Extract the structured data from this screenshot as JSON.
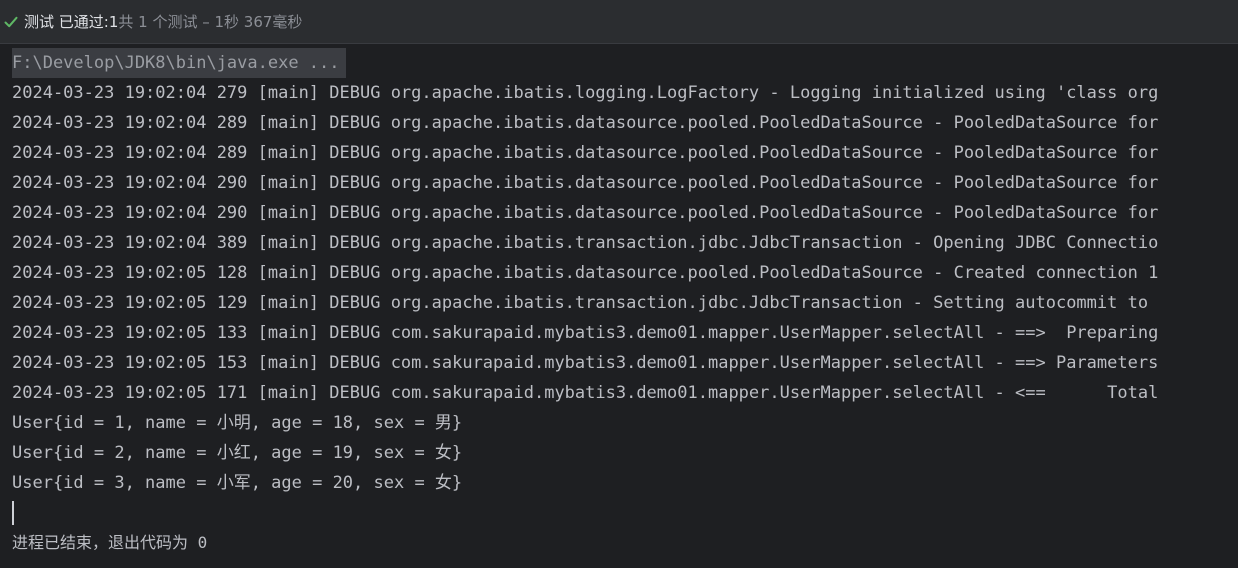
{
  "status_bar": {
    "icon": "check-icon",
    "icon_color": "#5fb865",
    "passed_label": "测试 已通过: ",
    "passed_count": "1",
    "detail": "共 1 个测试 – 1秒 367毫秒"
  },
  "console": {
    "command": "F:\\Develop\\JDK8\\bin\\java.exe ...",
    "log_lines": [
      "2024-03-23 19:02:04 279 [main] DEBUG org.apache.ibatis.logging.LogFactory - Logging initialized using 'class org",
      "2024-03-23 19:02:04 289 [main] DEBUG org.apache.ibatis.datasource.pooled.PooledDataSource - PooledDataSource for",
      "2024-03-23 19:02:04 289 [main] DEBUG org.apache.ibatis.datasource.pooled.PooledDataSource - PooledDataSource for",
      "2024-03-23 19:02:04 290 [main] DEBUG org.apache.ibatis.datasource.pooled.PooledDataSource - PooledDataSource for",
      "2024-03-23 19:02:04 290 [main] DEBUG org.apache.ibatis.datasource.pooled.PooledDataSource - PooledDataSource for",
      "2024-03-23 19:02:04 389 [main] DEBUG org.apache.ibatis.transaction.jdbc.JdbcTransaction - Opening JDBC Connectio",
      "2024-03-23 19:02:05 128 [main] DEBUG org.apache.ibatis.datasource.pooled.PooledDataSource - Created connection 1",
      "2024-03-23 19:02:05 129 [main] DEBUG org.apache.ibatis.transaction.jdbc.JdbcTransaction - Setting autocommit to",
      "2024-03-23 19:02:05 133 [main] DEBUG com.sakurapaid.mybatis3.demo01.mapper.UserMapper.selectAll - ==>  Preparing",
      "2024-03-23 19:02:05 153 [main] DEBUG com.sakurapaid.mybatis3.demo01.mapper.UserMapper.selectAll - ==> Parameters",
      "2024-03-23 19:02:05 171 [main] DEBUG com.sakurapaid.mybatis3.demo01.mapper.UserMapper.selectAll - <==      Total"
    ],
    "output_lines": [
      "User{id = 1, name = 小明, age = 18, sex = 男}",
      "User{id = 2, name = 小红, age = 19, sex = 女}",
      "User{id = 3, name = 小军, age = 20, sex = 女}"
    ],
    "finish_message": "进程已结束，退出代码为 0"
  }
}
